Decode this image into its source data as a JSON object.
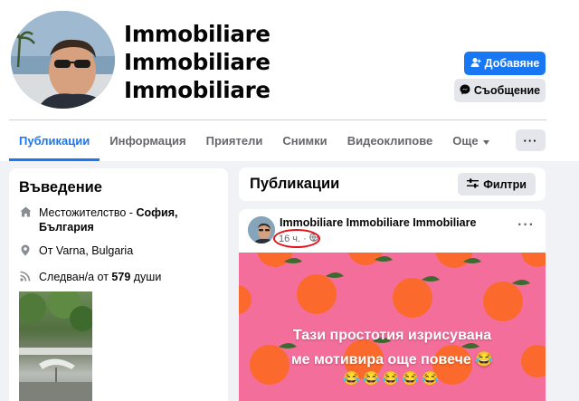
{
  "profile": {
    "name_lines": [
      "Immobiliare",
      "Immobiliare",
      "Immobiliare"
    ],
    "actions": {
      "add_label": "Добавяне",
      "message_label": "Съобщение"
    }
  },
  "tabs": [
    {
      "label": "Публикации",
      "active": true
    },
    {
      "label": "Информация",
      "active": false
    },
    {
      "label": "Приятели",
      "active": false
    },
    {
      "label": "Снимки",
      "active": false
    },
    {
      "label": "Видеоклипове",
      "active": false
    },
    {
      "label": "Още",
      "active": false
    }
  ],
  "more_menu_label": "···",
  "intro": {
    "title": "Въведение",
    "lives_in_prefix": "Местожителство - ",
    "lives_in_value": "София, България",
    "from_prefix": "От ",
    "from_value": "Varna, Bulgaria",
    "followers_prefix": "Следван/а от ",
    "followers_count": "579",
    "followers_suffix": " души"
  },
  "posts_section": {
    "title": "Публикации",
    "filter_label": "Филтри"
  },
  "post": {
    "author": "Immobiliare Immobiliare Immobiliare",
    "time": "16 ч.",
    "separator": "·",
    "menu_label": "···",
    "image_text_line1": "Тази простотия изрисувана",
    "image_text_line2": "ме мотивира още повече 😂",
    "emojis": "😂😂😂😂😂"
  },
  "colors": {
    "accent": "#1877f2",
    "annotation": "#e4111a",
    "post_background": "#f36e9a",
    "orange_fruit": "#fb6a2c"
  }
}
